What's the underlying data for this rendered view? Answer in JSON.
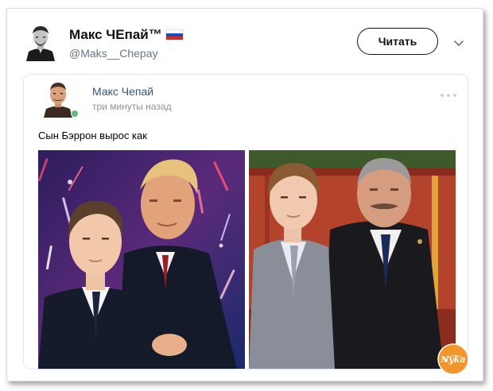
{
  "header": {
    "display_name": "Макс ЧЕпай™",
    "handle": "@Maks__Chepay",
    "follow_label": "Читать",
    "flag_colors": [
      "#ffffff",
      "#1c48c4",
      "#d52b1e"
    ]
  },
  "quoted_post": {
    "author": "Макс Чепай",
    "time": "три минуты назад",
    "text": "Сын Бэррон вырос как",
    "online_color": "#5cbf7a",
    "images": [
      {
        "subject": "photo-boy-and-man-stage"
      },
      {
        "subject": "photo-boy-and-man-hall"
      }
    ]
  },
  "watermark": {
    "text": "Nyka",
    "color": "#f0962a"
  },
  "icons": {
    "more": "more-dots-icon",
    "menu": "chevron-down-icon"
  }
}
